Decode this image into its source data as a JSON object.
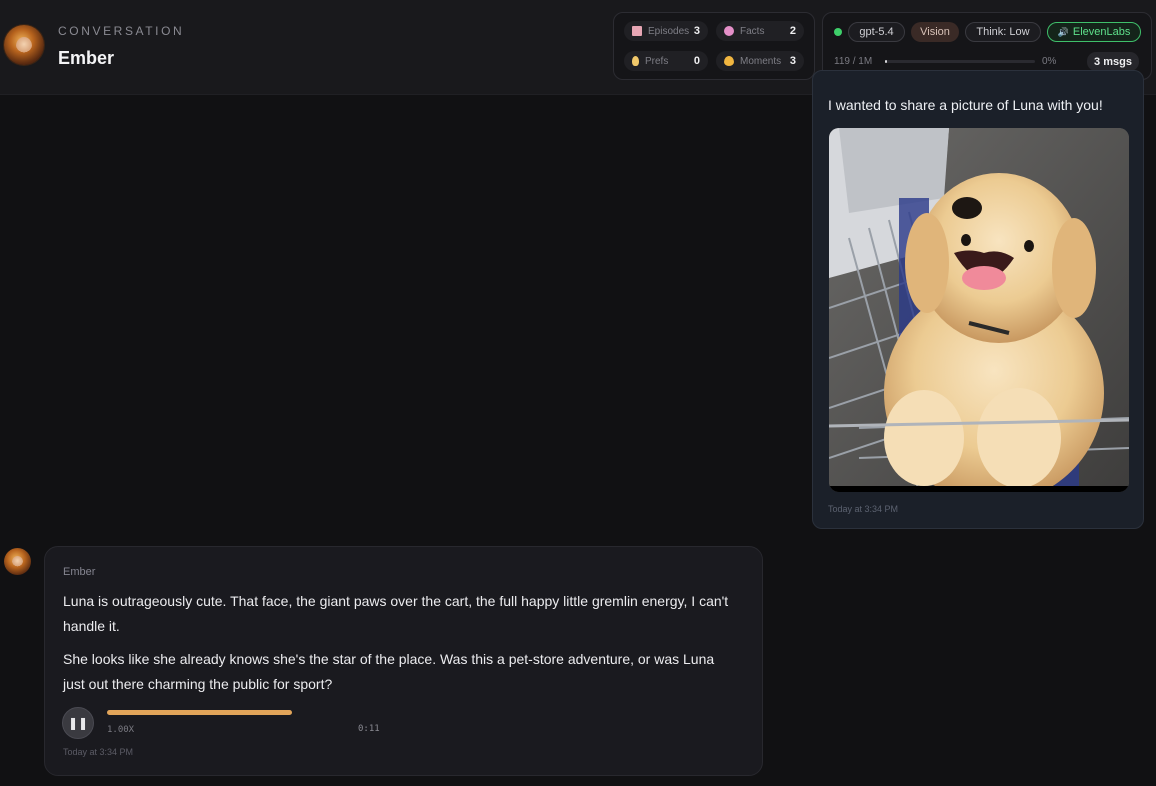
{
  "header": {
    "label": "CONVERSATION",
    "name": "Ember"
  },
  "memory": {
    "episodes": {
      "label": "Episodes",
      "count": "3"
    },
    "facts": {
      "label": "Facts",
      "count": "2"
    },
    "prefs": {
      "label": "Prefs",
      "count": "0"
    },
    "moments": {
      "label": "Moments",
      "count": "3"
    }
  },
  "model": {
    "name": "gpt-5.4",
    "vision": "Vision",
    "think": "Think: Low",
    "voice": "ElevenLabs",
    "tokens": "119 / 1M",
    "token_usage_pct": "0%",
    "token_usage_fraction": 0.0001,
    "messages": "3 msgs"
  },
  "user_message": {
    "text": "I wanted to share a picture of Luna with you!",
    "time": "Today at 3:34 PM"
  },
  "bot_message": {
    "sender": "Ember",
    "paragraph1": "Luna is outrageously cute. That face, the giant paws over the cart, the full happy little gremlin energy, I can't handle it.",
    "paragraph2": "She looks like she already knows she's the star of the place. Was this a pet-store adventure, or was Luna just out there charming the public for sport?",
    "audio": {
      "speed": "1.00X",
      "duration": "0:11",
      "progress_fraction": 1.0
    },
    "time": "Today at 3:34 PM"
  },
  "colors": {
    "online": "#3ecf6a",
    "voice_accent": "#5ee08a",
    "audio_bar": "#e2a55a"
  }
}
